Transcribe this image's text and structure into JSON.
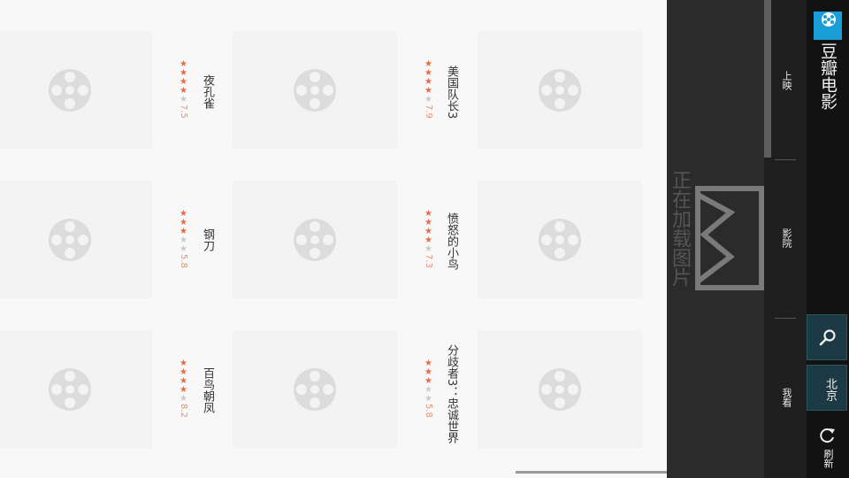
{
  "app": {
    "title": "豆瓣电影"
  },
  "tabs": [
    {
      "label": "上映"
    },
    {
      "label": "影院"
    },
    {
      "label": "我看"
    }
  ],
  "sidebar": {
    "city": "北京",
    "refresh_label": "刷新"
  },
  "loading": {
    "text": "正在加载图片"
  },
  "movies": [
    {
      "title": "美国队长3",
      "stars": 3.5,
      "score": "7.9"
    },
    {
      "title": "夜孔雀",
      "stars": 3.5,
      "score": "7.5"
    },
    {
      "title": "愤怒的小鸟",
      "stars": 3.5,
      "score": "7.3"
    },
    {
      "title": "钢刀",
      "stars": 3,
      "score": "5.8"
    },
    {
      "title": "分歧者3：忠诚世界",
      "stars": 3,
      "score": "5.8"
    },
    {
      "title": "百鸟朝凤",
      "stars": 4,
      "score": "8.2"
    }
  ],
  "colors": {
    "star_on": "#e66a47",
    "star_off": "#c9c9c9",
    "score": "#e59070",
    "accent": "#1b3a44"
  }
}
